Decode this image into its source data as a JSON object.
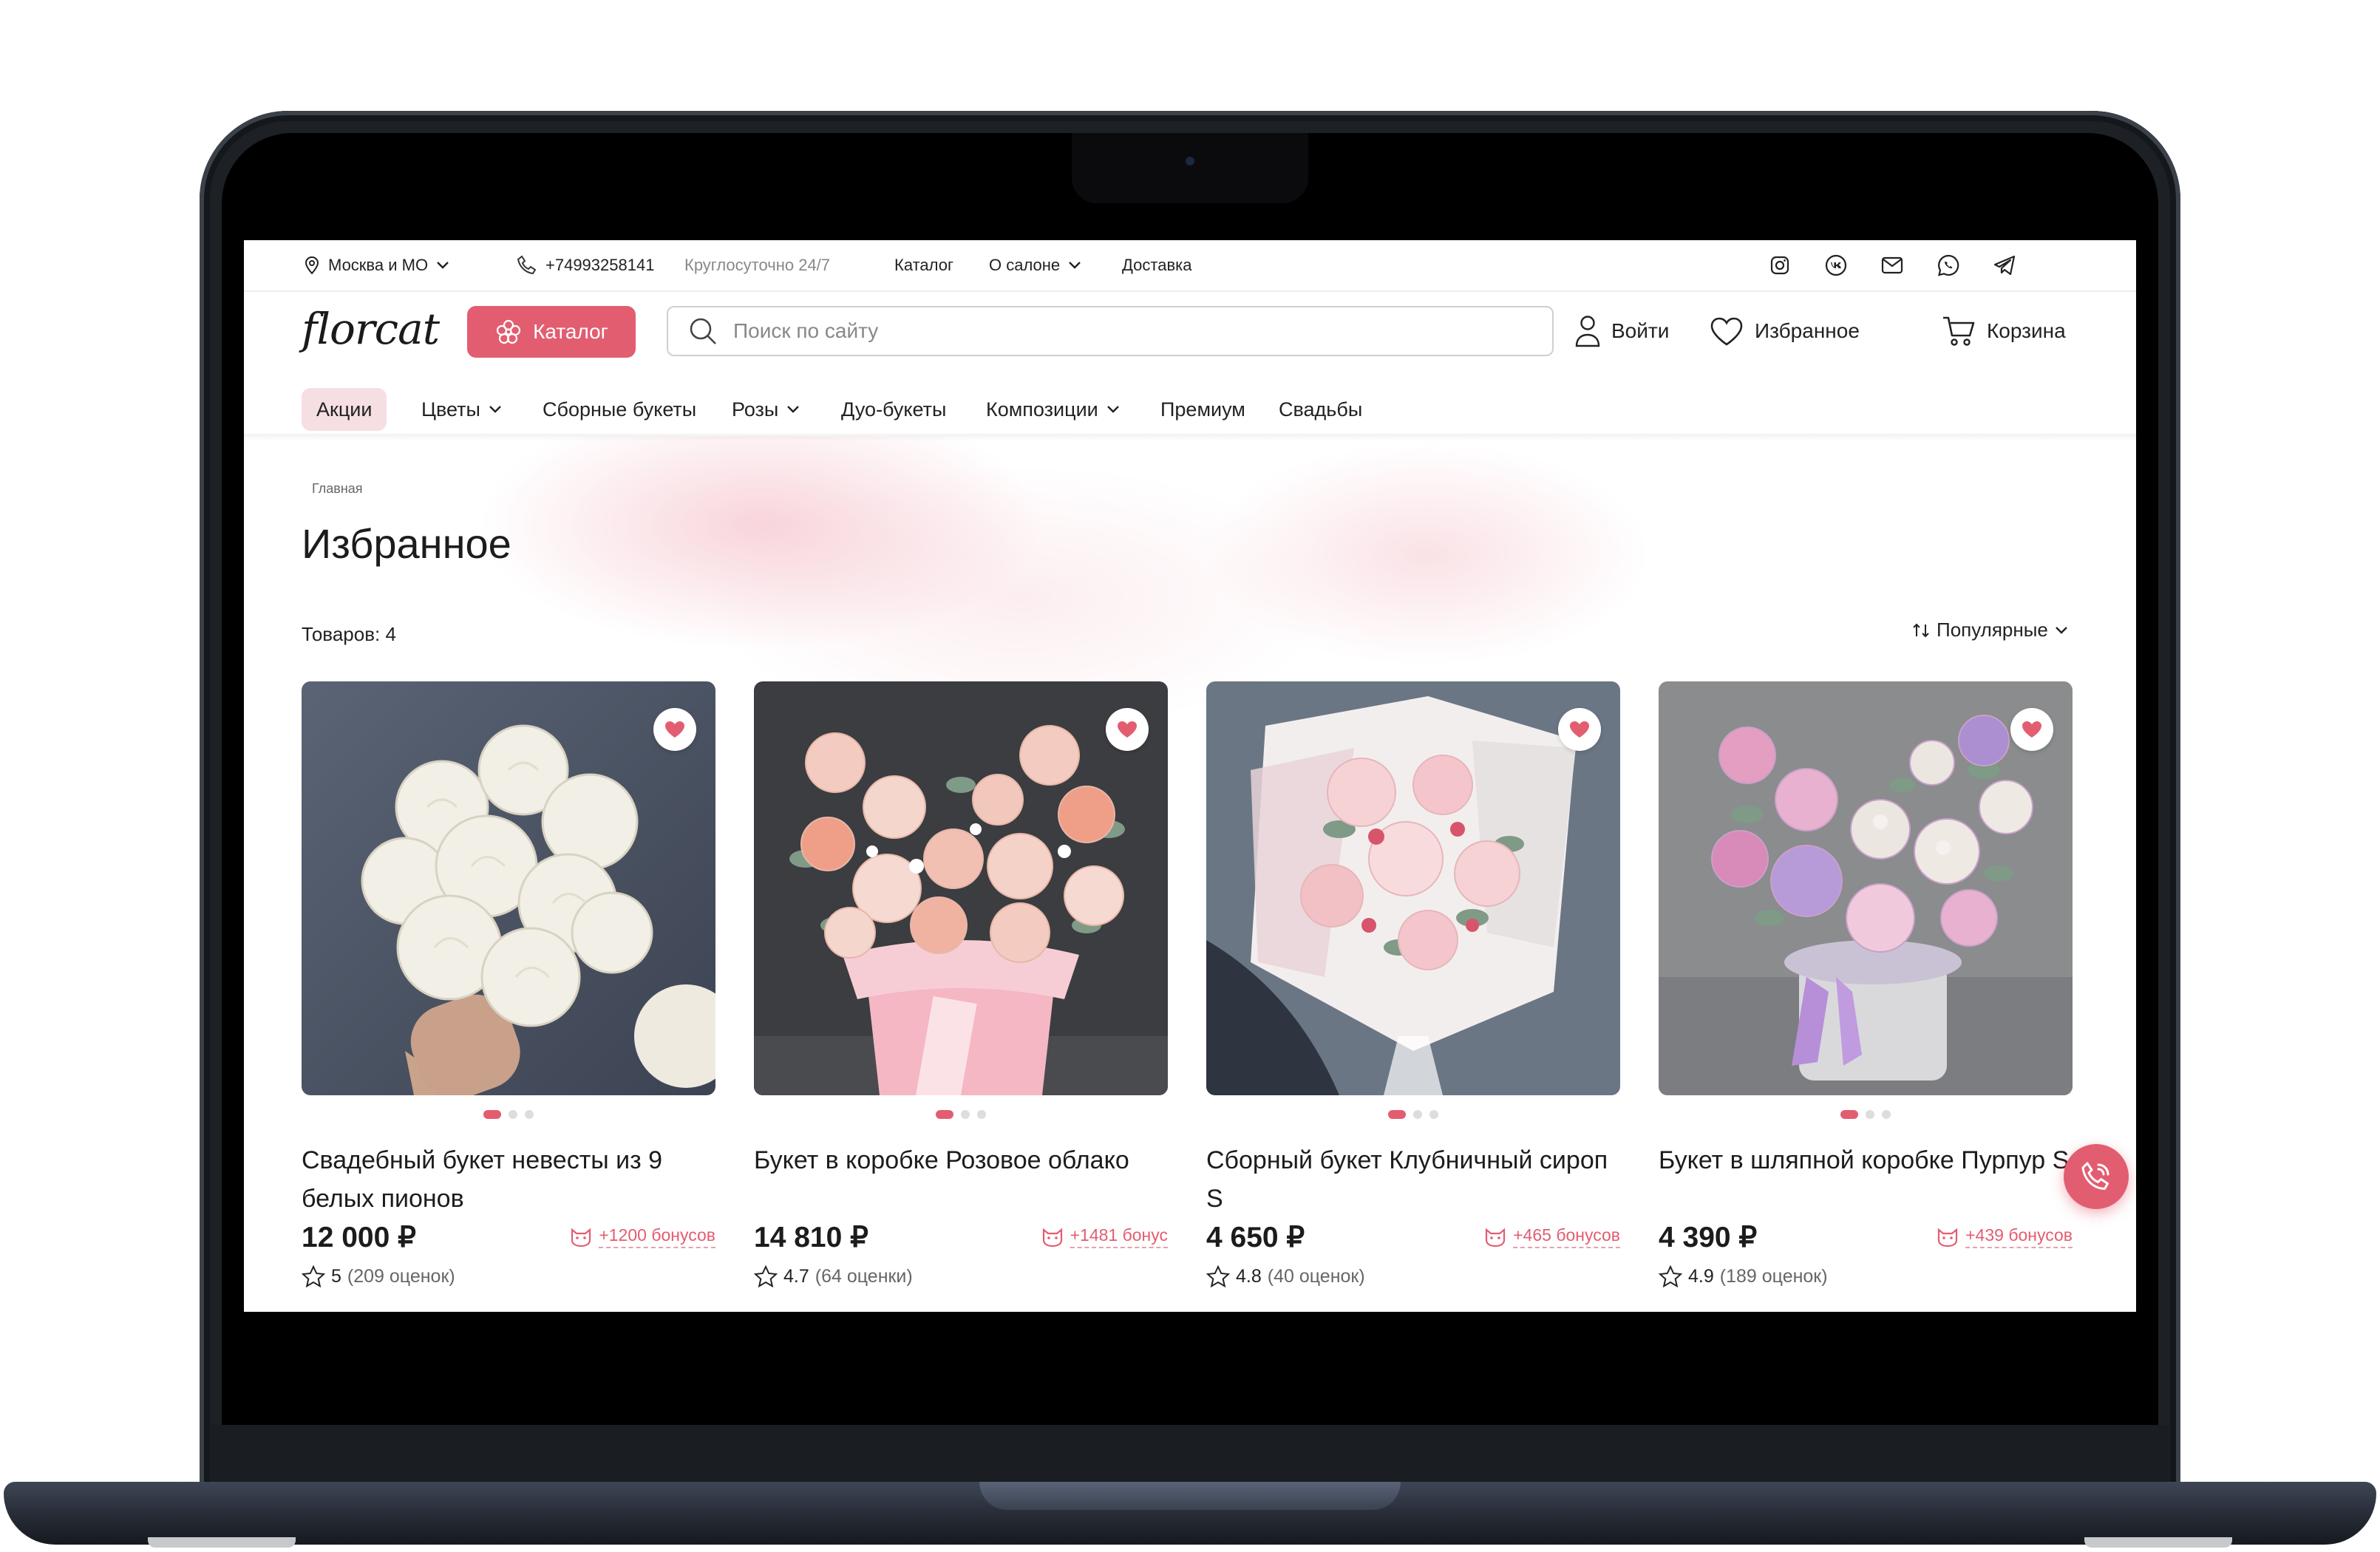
{
  "topbar": {
    "region": "Москва и МО",
    "phone": "+74993258141",
    "hours": "Круглосуточно 24/7",
    "links": [
      "Каталог",
      "О салоне",
      "Доставка"
    ],
    "social_icons": [
      "instagram-icon",
      "vk-icon",
      "mail-icon",
      "whatsapp-icon",
      "telegram-icon"
    ]
  },
  "header": {
    "logo": "florcat",
    "catalog_label": "Каталог",
    "search_placeholder": "Поиск по сайту",
    "login_label": "Войти",
    "favorites_label": "Избранное",
    "cart_label": "Корзина"
  },
  "nav": {
    "items": [
      "Акции",
      "Цветы",
      "Сборные букеты",
      "Розы",
      "Дуо-букеты",
      "Композиции",
      "Премиум",
      "Свадьбы"
    ],
    "active": "Акции"
  },
  "breadcrumb": "Главная",
  "page_title": "Избранное",
  "count_label": "Товаров: 4",
  "sort_label": "Популярные",
  "products": [
    {
      "title": "Свадебный букет невесты из 9 белых пионов",
      "price": "12 000 ₽",
      "bonus": "+1200 бонусов",
      "rating": "5",
      "reviews": "(209 оценок)"
    },
    {
      "title": "Букет в коробке Розовое облако",
      "price": "14 810 ₽",
      "bonus": "+1481 бонус",
      "rating": "4.7",
      "reviews": "(64 оценки)"
    },
    {
      "title": "Сборный букет Клубничный сироп S",
      "price": "4 650 ₽",
      "bonus": "+465 бонусов",
      "rating": "4.8",
      "reviews": "(40 оценок)"
    },
    {
      "title": "Букет в шляпной коробке Пурпур S",
      "price": "4 390 ₽",
      "bonus": "+439 бонусов",
      "rating": "4.9",
      "reviews": "(189 оценок)"
    }
  ],
  "colors": {
    "accent": "#e35d70",
    "accent_soft": "#f6dfe3",
    "text": "#1c1c1c"
  }
}
